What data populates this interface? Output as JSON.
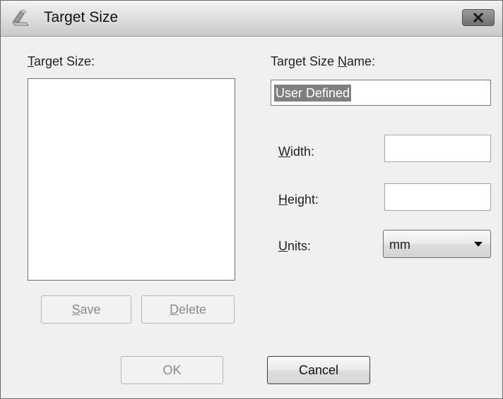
{
  "window": {
    "title": "Target Size",
    "icon": "scanner-icon",
    "close_icon": "close-icon"
  },
  "left": {
    "list_label_hotkey": "T",
    "list_label_rest": "arget Size:",
    "save_hotkey": "S",
    "save_rest": "ave",
    "delete_hotkey": "D",
    "delete_rest": "elete"
  },
  "right": {
    "name_label_pre": "Target Size ",
    "name_label_hotkey": "N",
    "name_label_post": "ame:",
    "name_value": "User Defined",
    "width_hotkey": "W",
    "width_rest": "idth:",
    "width_value": "",
    "height_hotkey": "H",
    "height_rest": "eight:",
    "height_value": "",
    "units_hotkey": "U",
    "units_rest": "nits:",
    "units_value": "mm"
  },
  "footer": {
    "ok_label": "OK",
    "cancel_label": "Cancel"
  }
}
